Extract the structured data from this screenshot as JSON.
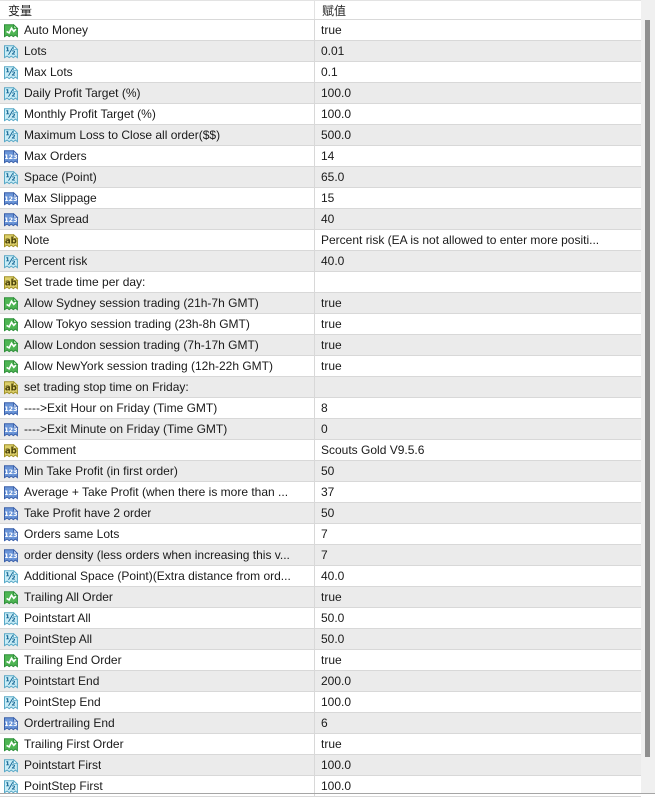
{
  "table": {
    "columns": [
      {
        "label": "变量"
      },
      {
        "label": "赋值"
      }
    ],
    "icons": {
      "boolean": "boolean-chart-icon",
      "double": "double-fraction-icon",
      "integer": "integer-123-icon",
      "string": "string-ab-icon"
    },
    "rows": [
      {
        "type": "boolean",
        "label": "Auto Money",
        "value": "true"
      },
      {
        "type": "double",
        "label": "Lots",
        "value": "0.01"
      },
      {
        "type": "double",
        "label": "Max Lots",
        "value": "0.1"
      },
      {
        "type": "double",
        "label": "Daily Profit Target (%)",
        "value": "100.0"
      },
      {
        "type": "double",
        "label": "Monthly Profit Target (%)",
        "value": "100.0"
      },
      {
        "type": "double",
        "label": "Maximum Loss to Close all order($$)",
        "value": "500.0"
      },
      {
        "type": "integer",
        "label": "Max Orders",
        "value": "14"
      },
      {
        "type": "double",
        "label": "Space (Point)",
        "value": "65.0"
      },
      {
        "type": "integer",
        "label": "Max Slippage",
        "value": "15"
      },
      {
        "type": "integer",
        "label": "Max Spread",
        "value": "40"
      },
      {
        "type": "string",
        "label": "Note",
        "value": "Percent risk (EA is not allowed to enter more positi..."
      },
      {
        "type": "double",
        "label": "Percent risk",
        "value": "40.0"
      },
      {
        "type": "string",
        "label": "Set trade time per day:",
        "value": ""
      },
      {
        "type": "boolean",
        "label": "Allow Sydney session trading (21h-7h GMT)",
        "value": "true"
      },
      {
        "type": "boolean",
        "label": "Allow Tokyo session trading (23h-8h GMT)",
        "value": "true"
      },
      {
        "type": "boolean",
        "label": "Allow London session trading (7h-17h GMT)",
        "value": "true"
      },
      {
        "type": "boolean",
        "label": "Allow NewYork session trading (12h-22h GMT)",
        "value": "true"
      },
      {
        "type": "string",
        "label": "set trading stop time on Friday:",
        "value": ""
      },
      {
        "type": "integer",
        "label": "---->Exit Hour on Friday (Time GMT)",
        "value": "8"
      },
      {
        "type": "integer",
        "label": "---->Exit Minute on Friday (Time GMT)",
        "value": "0"
      },
      {
        "type": "string",
        "label": "Comment",
        "value": "Scouts Gold V9.5.6"
      },
      {
        "type": "integer",
        "label": "Min Take Profit (in first order)",
        "value": "50"
      },
      {
        "type": "integer",
        "label": "Average + Take Profit (when there is more than ...",
        "value": "37"
      },
      {
        "type": "integer",
        "label": "Take Profit have 2 order",
        "value": "50"
      },
      {
        "type": "integer",
        "label": "Orders same Lots",
        "value": "7"
      },
      {
        "type": "integer",
        "label": "order density (less orders when increasing this v...",
        "value": "7"
      },
      {
        "type": "double",
        "label": "Additional Space (Point)(Extra distance from ord...",
        "value": "40.0"
      },
      {
        "type": "boolean",
        "label": "Trailing All Order",
        "value": "true"
      },
      {
        "type": "double",
        "label": "Pointstart All",
        "value": "50.0"
      },
      {
        "type": "double",
        "label": "PointStep All",
        "value": "50.0"
      },
      {
        "type": "boolean",
        "label": "Trailing End Order",
        "value": "true"
      },
      {
        "type": "double",
        "label": "Pointstart End",
        "value": "200.0"
      },
      {
        "type": "double",
        "label": "PointStep End",
        "value": "100.0"
      },
      {
        "type": "integer",
        "label": "Ordertrailing End",
        "value": "6"
      },
      {
        "type": "boolean",
        "label": "Trailing First Order",
        "value": "true"
      },
      {
        "type": "double",
        "label": "Pointstart First",
        "value": "100.0"
      },
      {
        "type": "double",
        "label": "PointStep First",
        "value": "100.0"
      }
    ]
  },
  "colors": {
    "row_alt": "#ebebeb",
    "row_border": "#d8d8d8",
    "icon_boolean": "#4eb553",
    "icon_double": "#c8ecf6",
    "icon_integer": "#6a95d8",
    "icon_string": "#ddd06b",
    "scrollbar_thumb": "#8f8f8f",
    "scrollbar_track": "#f0f0f0"
  }
}
